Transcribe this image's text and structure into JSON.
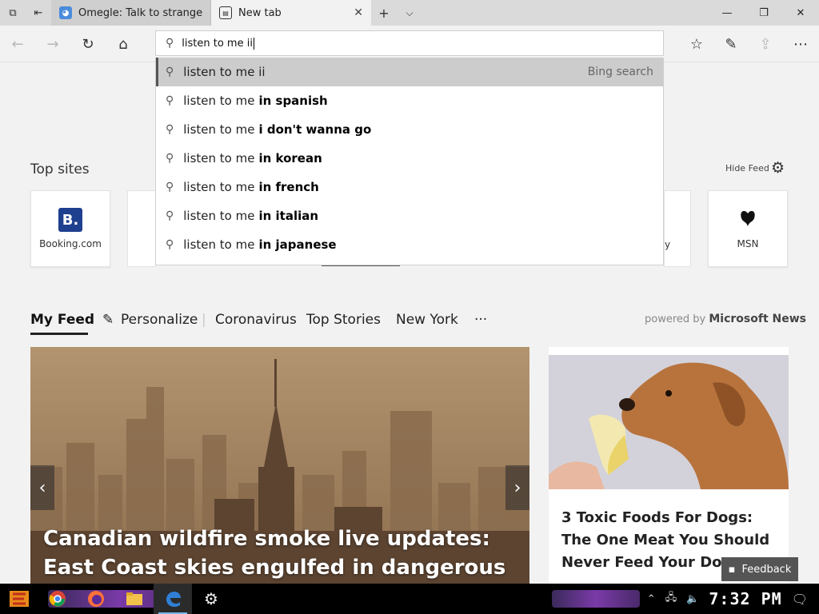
{
  "tabs": [
    {
      "label": "Omegle: Talk to strangers!",
      "active": false
    },
    {
      "label": "New tab",
      "active": true
    }
  ],
  "address": {
    "value": "listen to me ii"
  },
  "suggestions": [
    {
      "prefix": "listen to me ii",
      "bold": "",
      "note": "Bing search"
    },
    {
      "prefix": "listen to me",
      "bold": "in spanish",
      "note": ""
    },
    {
      "prefix": "listen to me",
      "bold": "i don't wanna go",
      "note": ""
    },
    {
      "prefix": "listen to me",
      "bold": "in korean",
      "note": ""
    },
    {
      "prefix": "listen to me",
      "bold": "in french",
      "note": ""
    },
    {
      "prefix": "listen to me",
      "bold": "in italian",
      "note": ""
    },
    {
      "prefix": "listen to me",
      "bold": "in japanese",
      "note": ""
    }
  ],
  "top_sites": {
    "title": "Top sites",
    "hide_feed": "Hide Feed",
    "tiles": [
      {
        "name": "Booking.com",
        "logo": "B."
      },
      {
        "name": "MSN",
        "logo": "msn-butterfly-icon"
      }
    ],
    "partial_label": "y"
  },
  "feed_nav": {
    "my_feed": "My Feed",
    "personalize": "Personalize",
    "items": [
      "Coronavirus",
      "Top Stories",
      "New York"
    ],
    "more": "···",
    "powered_by": "powered by",
    "provider": "Microsoft News"
  },
  "hero": {
    "title": "Canadian wildfire smoke live updates: East Coast skies engulfed in dangerous haze"
  },
  "card": {
    "title": "3 Toxic Foods For Dogs: The One Meat You Should Never Feed Your Dog"
  },
  "feedback": {
    "label": "Feedback"
  },
  "taskbar": {
    "clock": "7:32 PM"
  }
}
